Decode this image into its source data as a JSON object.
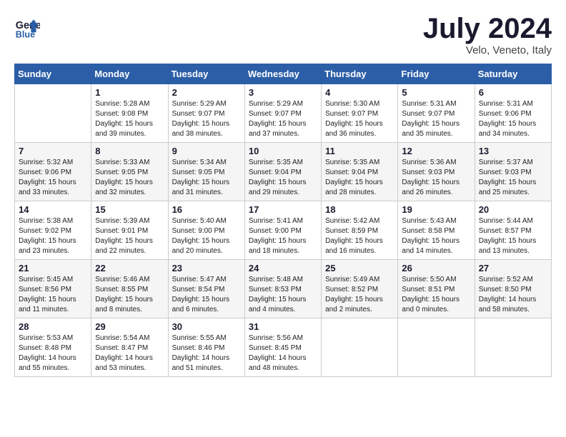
{
  "header": {
    "logo_line1": "General",
    "logo_line2": "Blue",
    "month_title": "July 2024",
    "subtitle": "Velo, Veneto, Italy"
  },
  "weekdays": [
    "Sunday",
    "Monday",
    "Tuesday",
    "Wednesday",
    "Thursday",
    "Friday",
    "Saturday"
  ],
  "weeks": [
    [
      {
        "day": "",
        "info": ""
      },
      {
        "day": "1",
        "info": "Sunrise: 5:28 AM\nSunset: 9:08 PM\nDaylight: 15 hours\nand 39 minutes."
      },
      {
        "day": "2",
        "info": "Sunrise: 5:29 AM\nSunset: 9:07 PM\nDaylight: 15 hours\nand 38 minutes."
      },
      {
        "day": "3",
        "info": "Sunrise: 5:29 AM\nSunset: 9:07 PM\nDaylight: 15 hours\nand 37 minutes."
      },
      {
        "day": "4",
        "info": "Sunrise: 5:30 AM\nSunset: 9:07 PM\nDaylight: 15 hours\nand 36 minutes."
      },
      {
        "day": "5",
        "info": "Sunrise: 5:31 AM\nSunset: 9:07 PM\nDaylight: 15 hours\nand 35 minutes."
      },
      {
        "day": "6",
        "info": "Sunrise: 5:31 AM\nSunset: 9:06 PM\nDaylight: 15 hours\nand 34 minutes."
      }
    ],
    [
      {
        "day": "7",
        "info": "Sunrise: 5:32 AM\nSunset: 9:06 PM\nDaylight: 15 hours\nand 33 minutes."
      },
      {
        "day": "8",
        "info": "Sunrise: 5:33 AM\nSunset: 9:05 PM\nDaylight: 15 hours\nand 32 minutes."
      },
      {
        "day": "9",
        "info": "Sunrise: 5:34 AM\nSunset: 9:05 PM\nDaylight: 15 hours\nand 31 minutes."
      },
      {
        "day": "10",
        "info": "Sunrise: 5:35 AM\nSunset: 9:04 PM\nDaylight: 15 hours\nand 29 minutes."
      },
      {
        "day": "11",
        "info": "Sunrise: 5:35 AM\nSunset: 9:04 PM\nDaylight: 15 hours\nand 28 minutes."
      },
      {
        "day": "12",
        "info": "Sunrise: 5:36 AM\nSunset: 9:03 PM\nDaylight: 15 hours\nand 26 minutes."
      },
      {
        "day": "13",
        "info": "Sunrise: 5:37 AM\nSunset: 9:03 PM\nDaylight: 15 hours\nand 25 minutes."
      }
    ],
    [
      {
        "day": "14",
        "info": "Sunrise: 5:38 AM\nSunset: 9:02 PM\nDaylight: 15 hours\nand 23 minutes."
      },
      {
        "day": "15",
        "info": "Sunrise: 5:39 AM\nSunset: 9:01 PM\nDaylight: 15 hours\nand 22 minutes."
      },
      {
        "day": "16",
        "info": "Sunrise: 5:40 AM\nSunset: 9:00 PM\nDaylight: 15 hours\nand 20 minutes."
      },
      {
        "day": "17",
        "info": "Sunrise: 5:41 AM\nSunset: 9:00 PM\nDaylight: 15 hours\nand 18 minutes."
      },
      {
        "day": "18",
        "info": "Sunrise: 5:42 AM\nSunset: 8:59 PM\nDaylight: 15 hours\nand 16 minutes."
      },
      {
        "day": "19",
        "info": "Sunrise: 5:43 AM\nSunset: 8:58 PM\nDaylight: 15 hours\nand 14 minutes."
      },
      {
        "day": "20",
        "info": "Sunrise: 5:44 AM\nSunset: 8:57 PM\nDaylight: 15 hours\nand 13 minutes."
      }
    ],
    [
      {
        "day": "21",
        "info": "Sunrise: 5:45 AM\nSunset: 8:56 PM\nDaylight: 15 hours\nand 11 minutes."
      },
      {
        "day": "22",
        "info": "Sunrise: 5:46 AM\nSunset: 8:55 PM\nDaylight: 15 hours\nand 8 minutes."
      },
      {
        "day": "23",
        "info": "Sunrise: 5:47 AM\nSunset: 8:54 PM\nDaylight: 15 hours\nand 6 minutes."
      },
      {
        "day": "24",
        "info": "Sunrise: 5:48 AM\nSunset: 8:53 PM\nDaylight: 15 hours\nand 4 minutes."
      },
      {
        "day": "25",
        "info": "Sunrise: 5:49 AM\nSunset: 8:52 PM\nDaylight: 15 hours\nand 2 minutes."
      },
      {
        "day": "26",
        "info": "Sunrise: 5:50 AM\nSunset: 8:51 PM\nDaylight: 15 hours\nand 0 minutes."
      },
      {
        "day": "27",
        "info": "Sunrise: 5:52 AM\nSunset: 8:50 PM\nDaylight: 14 hours\nand 58 minutes."
      }
    ],
    [
      {
        "day": "28",
        "info": "Sunrise: 5:53 AM\nSunset: 8:48 PM\nDaylight: 14 hours\nand 55 minutes."
      },
      {
        "day": "29",
        "info": "Sunrise: 5:54 AM\nSunset: 8:47 PM\nDaylight: 14 hours\nand 53 minutes."
      },
      {
        "day": "30",
        "info": "Sunrise: 5:55 AM\nSunset: 8:46 PM\nDaylight: 14 hours\nand 51 minutes."
      },
      {
        "day": "31",
        "info": "Sunrise: 5:56 AM\nSunset: 8:45 PM\nDaylight: 14 hours\nand 48 minutes."
      },
      {
        "day": "",
        "info": ""
      },
      {
        "day": "",
        "info": ""
      },
      {
        "day": "",
        "info": ""
      }
    ]
  ]
}
